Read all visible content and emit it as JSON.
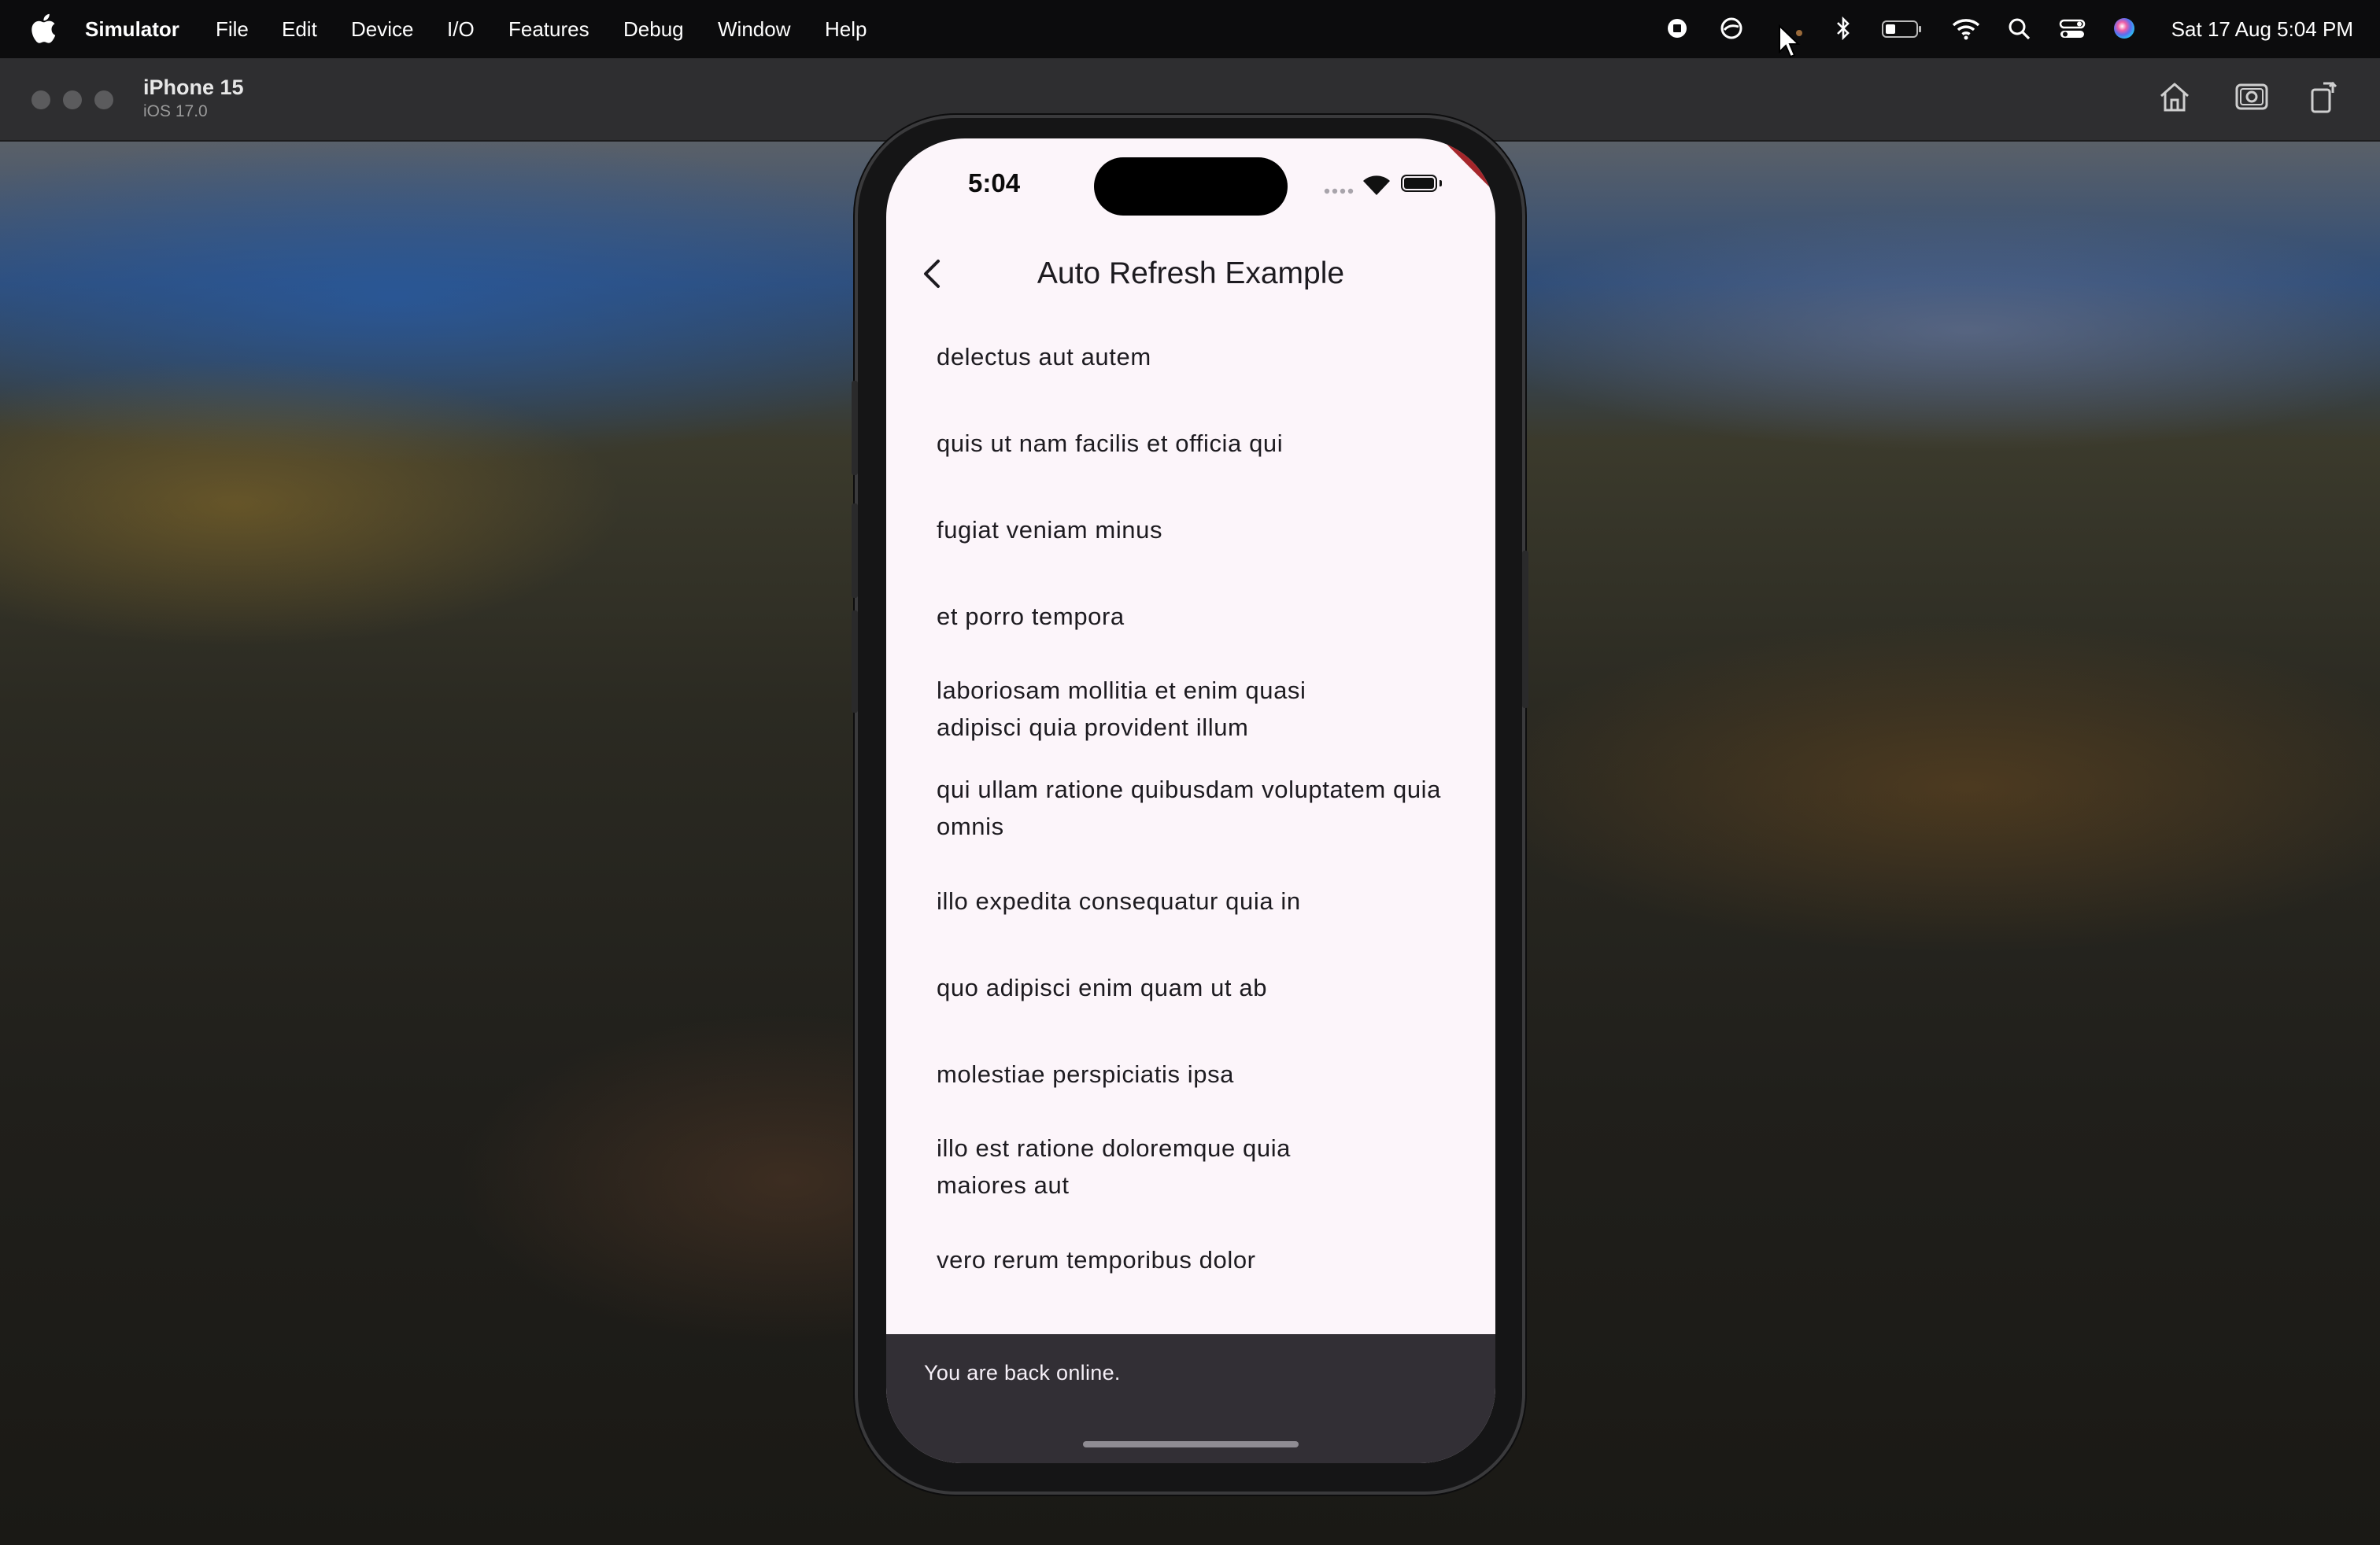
{
  "menubar": {
    "apple_icon": "apple-logo-icon",
    "app_name": "Simulator",
    "items": [
      "File",
      "Edit",
      "Device",
      "I/O",
      "Features",
      "Debug",
      "Window",
      "Help"
    ],
    "status_icons": [
      "record-icon",
      "activity-icon",
      "cursor-icon",
      "bluetooth-icon",
      "battery-icon",
      "wifi-icon",
      "search-icon",
      "control-center-icon",
      "siri-icon"
    ],
    "clock": "Sat 17 Aug  5:04 PM"
  },
  "simulator_window": {
    "device_name": "iPhone 15",
    "os_version": "iOS 17.0",
    "toolbar_icons": [
      "home-icon",
      "screenshot-icon",
      "rotate-icon"
    ]
  },
  "phone": {
    "status_bar": {
      "time": "5:04",
      "signal": "····",
      "debug_banner": "DEBUG"
    },
    "app_bar": {
      "title": "Auto Refresh Example",
      "back_icon": "chevron-left-icon"
    },
    "list_items": [
      {
        "text": "delectus aut autem"
      },
      {
        "text": "quis ut nam facilis et officia qui"
      },
      {
        "text": "fugiat veniam minus"
      },
      {
        "text": "et porro tempora"
      },
      {
        "text": "laboriosam mollitia et enim quasi adipisci quia provident illum"
      },
      {
        "text": "qui ullam ratione quibusdam voluptatem quia omnis"
      },
      {
        "text": "illo expedita consequatur quia in"
      },
      {
        "text": "quo adipisci enim quam ut ab"
      },
      {
        "text": "molestiae perspiciatis ipsa"
      },
      {
        "text": "illo est ratione doloremque quia maiores aut"
      },
      {
        "text": "vero rerum temporibus dolor"
      }
    ],
    "snackbar": {
      "message": "You are back online."
    }
  },
  "colors": {
    "menubar_bg": "#0c0c0d",
    "titlebar_bg": "#2e2e30",
    "screen_bg": "#fcf5fa",
    "snackbar_bg": "#322f35",
    "debug_ribbon": "#a5262b"
  }
}
